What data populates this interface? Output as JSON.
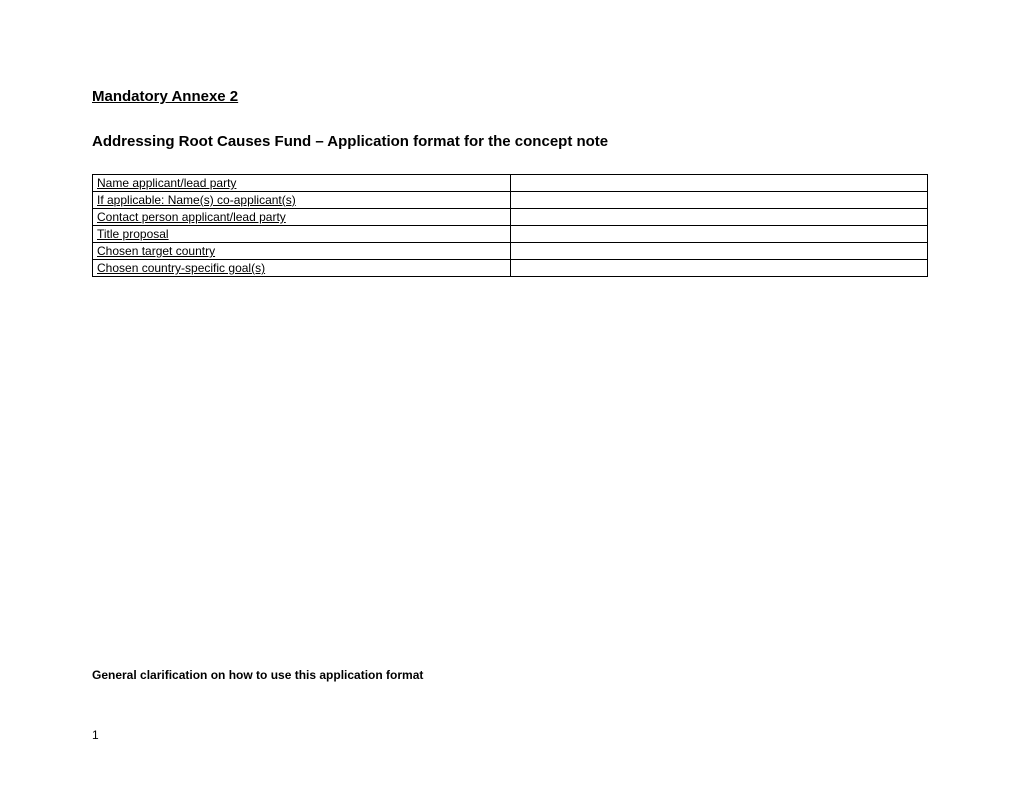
{
  "heading": {
    "main": "Mandatory Annexe 2",
    "sub": "Addressing Root Causes Fund – Application format for the concept note"
  },
  "table": {
    "rows": [
      {
        "label": "Name applicant/lead party",
        "value": ""
      },
      {
        "label": "If applicable: Name(s) co-applicant(s)",
        "value": ""
      },
      {
        "label": "Contact person applicant/lead party",
        "value": ""
      },
      {
        "label": "Title proposal",
        "value": ""
      },
      {
        "label": "Chosen target country",
        "value": ""
      },
      {
        "label": "Chosen country-specific goal(s)",
        "value": ""
      }
    ]
  },
  "clarification": "General clarification on how to use this application format",
  "pageNumber": "1"
}
